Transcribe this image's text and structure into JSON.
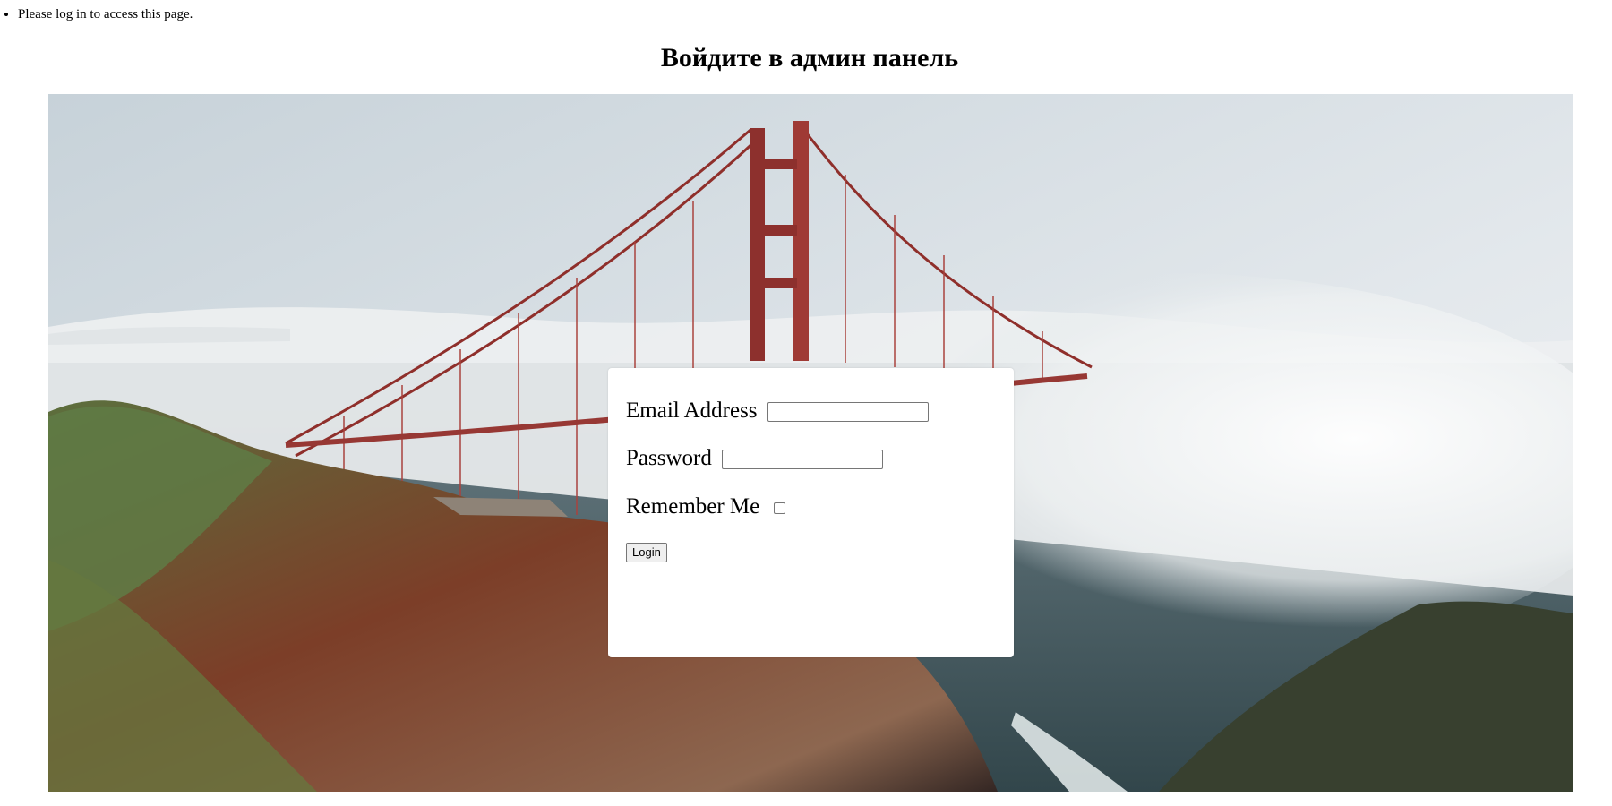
{
  "messages": [
    "Please log in to access this page."
  ],
  "page": {
    "title": "Войдите в админ панель"
  },
  "hero": {
    "image": "fog-covered-golden-gate-bridge-photo",
    "colors": {
      "sky": "#d8e0e6",
      "fog": "#eef1f3",
      "water": "#4a5f66",
      "bridge": "#a83b36",
      "hill": "#7a3a24",
      "vegetation": "#5f7b45"
    }
  },
  "form": {
    "email_label": "Email Address",
    "email_value": "",
    "password_label": "Password",
    "password_value": "",
    "remember_label": "Remember Me",
    "remember_checked": false,
    "login_label": "Login"
  }
}
